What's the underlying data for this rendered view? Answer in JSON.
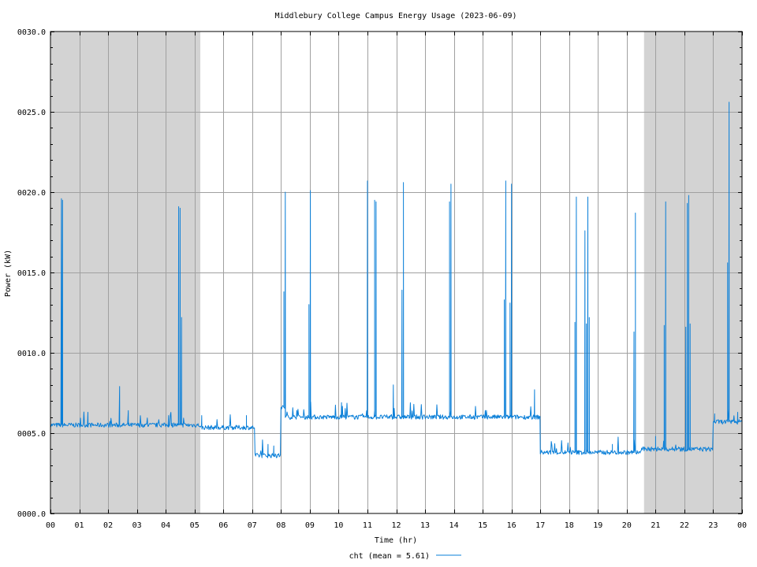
{
  "chart_data": {
    "type": "line",
    "title": "Middlebury College Campus Energy Usage (2023-06-09)",
    "xlabel": "Time (hr)",
    "ylabel": "Power (kW)",
    "xlim": [
      0,
      24
    ],
    "ylim": [
      0,
      30
    ],
    "x_tick_labels": [
      "00",
      "01",
      "02",
      "03",
      "04",
      "05",
      "06",
      "07",
      "08",
      "09",
      "10",
      "11",
      "12",
      "13",
      "14",
      "15",
      "16",
      "17",
      "18",
      "19",
      "20",
      "21",
      "22",
      "23",
      "00"
    ],
    "y_tick_labels": [
      "0000.0",
      "0005.0",
      "0010.0",
      "0015.0",
      "0020.0",
      "0025.0",
      "0030.0"
    ],
    "y_tick_values": [
      0,
      5,
      10,
      15,
      20,
      25,
      30
    ],
    "grid": true,
    "shaded_periods_hr": [
      [
        0,
        5.2
      ],
      [
        20.6,
        24
      ]
    ],
    "shade_color": "#d3d3d3",
    "grid_color": "#a0a0a0",
    "line_color": "#0a7fd8",
    "legend": {
      "placement": "bottom-center",
      "label": "cht (mean = 5.61)"
    },
    "series": [
      {
        "name": "cht",
        "baseline_segments": [
          {
            "start": 0.0,
            "end": 5.2,
            "level": 5.5
          },
          {
            "start": 5.2,
            "end": 7.1,
            "level": 5.35
          },
          {
            "start": 7.1,
            "end": 8.0,
            "level": 3.6
          },
          {
            "start": 8.0,
            "end": 8.15,
            "level": 6.6
          },
          {
            "start": 8.15,
            "end": 17.0,
            "level": 6.0
          },
          {
            "start": 17.0,
            "end": 20.5,
            "level": 3.8
          },
          {
            "start": 20.5,
            "end": 23.0,
            "level": 4.0
          },
          {
            "start": 23.0,
            "end": 24.0,
            "level": 5.7
          }
        ],
        "spikes": [
          {
            "x": 0.38,
            "y": 19.6
          },
          {
            "x": 0.42,
            "y": 19.5
          },
          {
            "x": 1.3,
            "y": 6.3
          },
          {
            "x": 2.4,
            "y": 7.9
          },
          {
            "x": 2.7,
            "y": 6.4
          },
          {
            "x": 4.1,
            "y": 6.1
          },
          {
            "x": 4.45,
            "y": 19.1
          },
          {
            "x": 4.5,
            "y": 19.0
          },
          {
            "x": 4.55,
            "y": 12.2
          },
          {
            "x": 5.25,
            "y": 6.1
          },
          {
            "x": 6.8,
            "y": 6.1
          },
          {
            "x": 7.55,
            "y": 4.3
          },
          {
            "x": 7.75,
            "y": 4.2
          },
          {
            "x": 8.1,
            "y": 13.8
          },
          {
            "x": 8.15,
            "y": 20.0
          },
          {
            "x": 8.97,
            "y": 13.0
          },
          {
            "x": 9.02,
            "y": 20.1
          },
          {
            "x": 10.1,
            "y": 6.9
          },
          {
            "x": 11.0,
            "y": 20.7
          },
          {
            "x": 11.25,
            "y": 19.5
          },
          {
            "x": 11.3,
            "y": 19.4
          },
          {
            "x": 11.9,
            "y": 8.0
          },
          {
            "x": 12.2,
            "y": 13.9
          },
          {
            "x": 12.25,
            "y": 20.6
          },
          {
            "x": 13.85,
            "y": 19.4
          },
          {
            "x": 13.9,
            "y": 20.5
          },
          {
            "x": 15.75,
            "y": 13.3
          },
          {
            "x": 15.8,
            "y": 20.7
          },
          {
            "x": 15.95,
            "y": 13.1
          },
          {
            "x": 16.0,
            "y": 20.5
          },
          {
            "x": 16.8,
            "y": 7.7
          },
          {
            "x": 18.2,
            "y": 11.9
          },
          {
            "x": 18.25,
            "y": 19.7
          },
          {
            "x": 18.55,
            "y": 17.6
          },
          {
            "x": 18.6,
            "y": 11.8
          },
          {
            "x": 18.65,
            "y": 19.7
          },
          {
            "x": 18.7,
            "y": 12.2
          },
          {
            "x": 19.5,
            "y": 4.3
          },
          {
            "x": 20.25,
            "y": 11.3
          },
          {
            "x": 20.3,
            "y": 18.7
          },
          {
            "x": 21.0,
            "y": 4.8
          },
          {
            "x": 21.3,
            "y": 11.7
          },
          {
            "x": 21.35,
            "y": 19.4
          },
          {
            "x": 22.05,
            "y": 11.6
          },
          {
            "x": 22.1,
            "y": 19.3
          },
          {
            "x": 22.15,
            "y": 19.8
          },
          {
            "x": 22.2,
            "y": 11.8
          },
          {
            "x": 23.05,
            "y": 6.2
          },
          {
            "x": 23.5,
            "y": 15.6
          },
          {
            "x": 23.55,
            "y": 25.6
          },
          {
            "x": 23.85,
            "y": 6.3
          }
        ]
      }
    ]
  }
}
